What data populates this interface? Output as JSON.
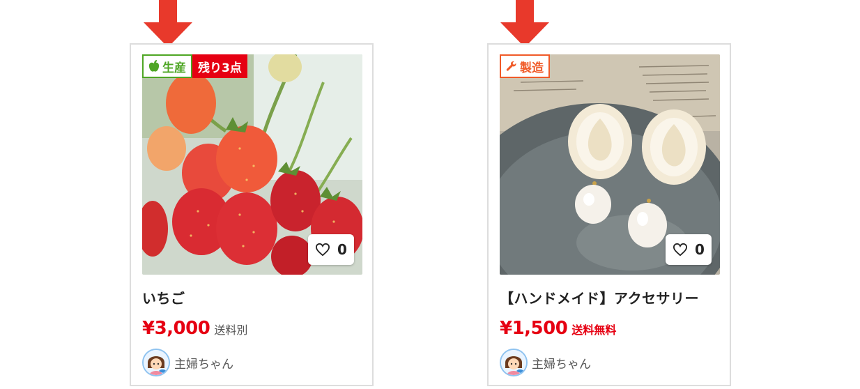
{
  "products": [
    {
      "category_badge": {
        "label": "生産",
        "icon": "apple-icon",
        "color": "#4ea624"
      },
      "stock_badge": {
        "label": "残り3点",
        "color": "#e60012"
      },
      "image": "strawberries-photo",
      "likes": "0",
      "title": "いちご",
      "price": "¥3,000",
      "shipping": "送料別",
      "seller": {
        "name": "主婦ちゃん",
        "avatar": "housewife-avatar"
      }
    },
    {
      "category_badge": {
        "label": "製造",
        "icon": "wrench-icon",
        "color": "#f05a28"
      },
      "image": "pearl-earrings-photo",
      "likes": "0",
      "title": "【ハンドメイド】アクセサリー",
      "price": "¥1,500",
      "shipping": "送料無料",
      "seller": {
        "name": "主婦ちゃん",
        "avatar": "housewife-avatar"
      }
    }
  ],
  "colors": {
    "price": "#e60012",
    "arrow": "#e8392b",
    "card_border": "#dddddd"
  }
}
